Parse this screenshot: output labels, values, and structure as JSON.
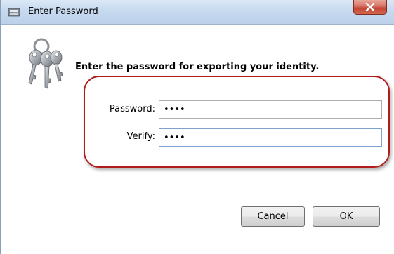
{
  "window": {
    "title": "Enter Password",
    "app_icon": "password-app-icon",
    "close_icon": "close-icon"
  },
  "dialog": {
    "icon": "keys-icon",
    "prompt": "Enter the password for exporting your identity.",
    "highlight_color": "#b01c1c"
  },
  "form": {
    "password_label": "Password:",
    "password_value": "1234",
    "verify_label": "Verify:",
    "verify_value": "1234"
  },
  "buttons": {
    "cancel_label": "Cancel",
    "ok_label": "OK"
  }
}
